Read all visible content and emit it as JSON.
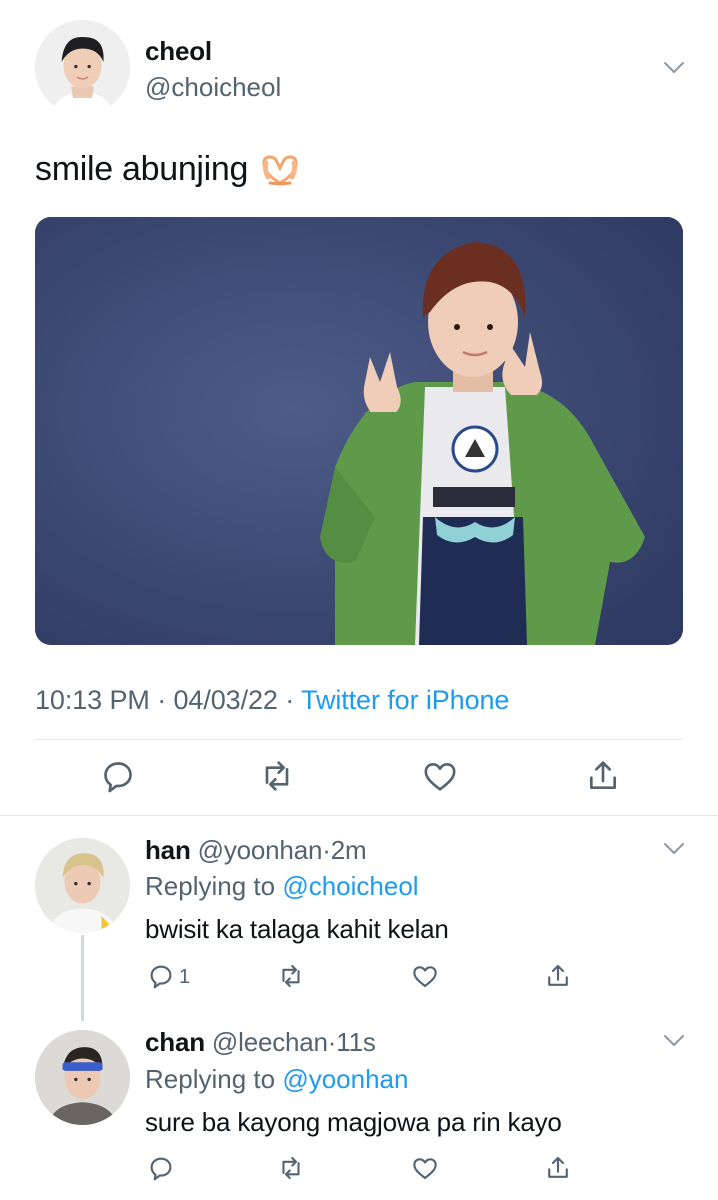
{
  "tweet": {
    "author_name": "cheol",
    "author_handle": "@choicheol",
    "text": "smile abunjing",
    "emoji": "heart-hands",
    "time": "10:13 PM",
    "date": "04/03/22",
    "source": "Twitter for iPhone",
    "sep": "·"
  },
  "replies": [
    {
      "name": "han",
      "handle": "@yoonhan",
      "time": "2m",
      "replying_label": "Replying to",
      "replying_to": "@choicheol",
      "text": "bwisit ka talaga kahit kelan",
      "reply_count": "1"
    },
    {
      "name": "chan",
      "handle": "@leechan",
      "time": "11s",
      "replying_label": "Replying to",
      "replying_to": "@yoonhan",
      "text": "sure ba kayong magjowa pa rin kayo",
      "reply_count": ""
    }
  ],
  "icons": [
    "chevron-down-icon",
    "reply-icon",
    "retweet-icon",
    "like-icon",
    "share-icon"
  ],
  "colors": {
    "link": "#1d9bf0",
    "muted": "#536471",
    "text": "#0f1419"
  }
}
